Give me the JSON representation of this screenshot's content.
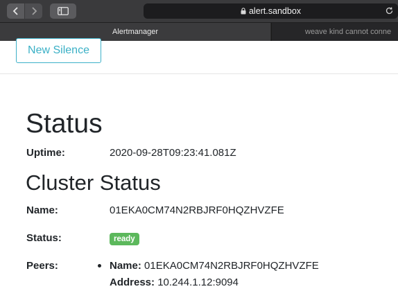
{
  "browser": {
    "url": "alert.sandbox",
    "tabs": [
      {
        "label": "Alertmanager",
        "active": true
      },
      {
        "label": "weave kind cannot conne",
        "active": false
      }
    ]
  },
  "header": {
    "new_silence_label": "New Silence",
    "accent_color": "#3ab0c6"
  },
  "status": {
    "title": "Status",
    "uptime_label": "Uptime:",
    "uptime_value": "2020-09-28T09:23:41.081Z"
  },
  "cluster": {
    "title": "Cluster Status",
    "name_label": "Name:",
    "name_value": "01EKA0CM74N2RBJRF0HQZHVZFE",
    "status_label": "Status:",
    "status_value": "ready",
    "status_color": "#5cb85c",
    "peers_label": "Peers:",
    "peers": [
      {
        "name_label": "Name:",
        "name_value": "01EKA0CM74N2RBJRF0HQZHVZFE",
        "address_label": "Address:",
        "address_value": "10.244.1.12:9094"
      }
    ]
  }
}
